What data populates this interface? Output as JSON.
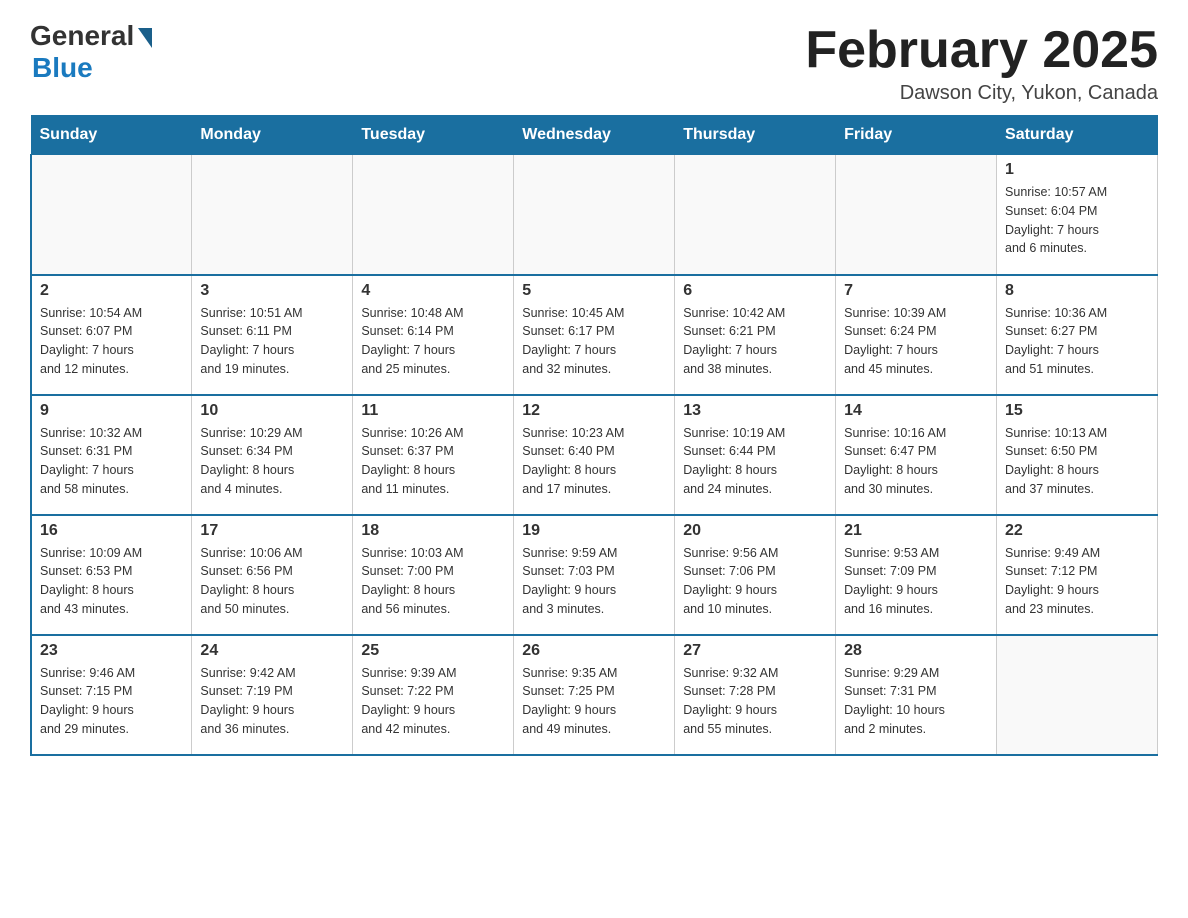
{
  "header": {
    "logo_general": "General",
    "logo_blue": "Blue",
    "month_year": "February 2025",
    "location": "Dawson City, Yukon, Canada"
  },
  "days_of_week": [
    "Sunday",
    "Monday",
    "Tuesday",
    "Wednesday",
    "Thursday",
    "Friday",
    "Saturday"
  ],
  "weeks": [
    [
      {
        "day": "",
        "info": ""
      },
      {
        "day": "",
        "info": ""
      },
      {
        "day": "",
        "info": ""
      },
      {
        "day": "",
        "info": ""
      },
      {
        "day": "",
        "info": ""
      },
      {
        "day": "",
        "info": ""
      },
      {
        "day": "1",
        "info": "Sunrise: 10:57 AM\nSunset: 6:04 PM\nDaylight: 7 hours\nand 6 minutes."
      }
    ],
    [
      {
        "day": "2",
        "info": "Sunrise: 10:54 AM\nSunset: 6:07 PM\nDaylight: 7 hours\nand 12 minutes."
      },
      {
        "day": "3",
        "info": "Sunrise: 10:51 AM\nSunset: 6:11 PM\nDaylight: 7 hours\nand 19 minutes."
      },
      {
        "day": "4",
        "info": "Sunrise: 10:48 AM\nSunset: 6:14 PM\nDaylight: 7 hours\nand 25 minutes."
      },
      {
        "day": "5",
        "info": "Sunrise: 10:45 AM\nSunset: 6:17 PM\nDaylight: 7 hours\nand 32 minutes."
      },
      {
        "day": "6",
        "info": "Sunrise: 10:42 AM\nSunset: 6:21 PM\nDaylight: 7 hours\nand 38 minutes."
      },
      {
        "day": "7",
        "info": "Sunrise: 10:39 AM\nSunset: 6:24 PM\nDaylight: 7 hours\nand 45 minutes."
      },
      {
        "day": "8",
        "info": "Sunrise: 10:36 AM\nSunset: 6:27 PM\nDaylight: 7 hours\nand 51 minutes."
      }
    ],
    [
      {
        "day": "9",
        "info": "Sunrise: 10:32 AM\nSunset: 6:31 PM\nDaylight: 7 hours\nand 58 minutes."
      },
      {
        "day": "10",
        "info": "Sunrise: 10:29 AM\nSunset: 6:34 PM\nDaylight: 8 hours\nand 4 minutes."
      },
      {
        "day": "11",
        "info": "Sunrise: 10:26 AM\nSunset: 6:37 PM\nDaylight: 8 hours\nand 11 minutes."
      },
      {
        "day": "12",
        "info": "Sunrise: 10:23 AM\nSunset: 6:40 PM\nDaylight: 8 hours\nand 17 minutes."
      },
      {
        "day": "13",
        "info": "Sunrise: 10:19 AM\nSunset: 6:44 PM\nDaylight: 8 hours\nand 24 minutes."
      },
      {
        "day": "14",
        "info": "Sunrise: 10:16 AM\nSunset: 6:47 PM\nDaylight: 8 hours\nand 30 minutes."
      },
      {
        "day": "15",
        "info": "Sunrise: 10:13 AM\nSunset: 6:50 PM\nDaylight: 8 hours\nand 37 minutes."
      }
    ],
    [
      {
        "day": "16",
        "info": "Sunrise: 10:09 AM\nSunset: 6:53 PM\nDaylight: 8 hours\nand 43 minutes."
      },
      {
        "day": "17",
        "info": "Sunrise: 10:06 AM\nSunset: 6:56 PM\nDaylight: 8 hours\nand 50 minutes."
      },
      {
        "day": "18",
        "info": "Sunrise: 10:03 AM\nSunset: 7:00 PM\nDaylight: 8 hours\nand 56 minutes."
      },
      {
        "day": "19",
        "info": "Sunrise: 9:59 AM\nSunset: 7:03 PM\nDaylight: 9 hours\nand 3 minutes."
      },
      {
        "day": "20",
        "info": "Sunrise: 9:56 AM\nSunset: 7:06 PM\nDaylight: 9 hours\nand 10 minutes."
      },
      {
        "day": "21",
        "info": "Sunrise: 9:53 AM\nSunset: 7:09 PM\nDaylight: 9 hours\nand 16 minutes."
      },
      {
        "day": "22",
        "info": "Sunrise: 9:49 AM\nSunset: 7:12 PM\nDaylight: 9 hours\nand 23 minutes."
      }
    ],
    [
      {
        "day": "23",
        "info": "Sunrise: 9:46 AM\nSunset: 7:15 PM\nDaylight: 9 hours\nand 29 minutes."
      },
      {
        "day": "24",
        "info": "Sunrise: 9:42 AM\nSunset: 7:19 PM\nDaylight: 9 hours\nand 36 minutes."
      },
      {
        "day": "25",
        "info": "Sunrise: 9:39 AM\nSunset: 7:22 PM\nDaylight: 9 hours\nand 42 minutes."
      },
      {
        "day": "26",
        "info": "Sunrise: 9:35 AM\nSunset: 7:25 PM\nDaylight: 9 hours\nand 49 minutes."
      },
      {
        "day": "27",
        "info": "Sunrise: 9:32 AM\nSunset: 7:28 PM\nDaylight: 9 hours\nand 55 minutes."
      },
      {
        "day": "28",
        "info": "Sunrise: 9:29 AM\nSunset: 7:31 PM\nDaylight: 10 hours\nand 2 minutes."
      },
      {
        "day": "",
        "info": ""
      }
    ]
  ]
}
